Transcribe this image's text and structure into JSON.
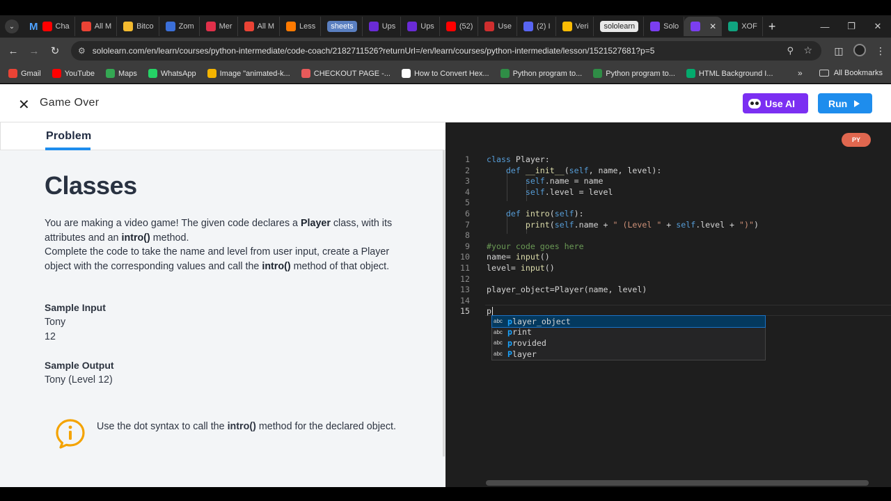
{
  "browser": {
    "tabs": [
      {
        "label": "Cha",
        "color": "#ff0000"
      },
      {
        "label": "All M",
        "color": "#ea4335"
      },
      {
        "label": "Bitco",
        "color": "#f3ba2f"
      },
      {
        "label": "Zom",
        "color": "#3b6fd8"
      },
      {
        "label": "Mer",
        "color": "#e0304a"
      },
      {
        "label": "All M",
        "color": "#ea4335"
      },
      {
        "label": "Less",
        "color": "#ff7a00"
      },
      {
        "label": "sheets",
        "color": "#5a7fc0"
      },
      {
        "label": "Ups",
        "color": "#6a2bd6"
      },
      {
        "label": "Ups",
        "color": "#6a2bd6"
      },
      {
        "label": "(52)",
        "color": "#ff0000"
      },
      {
        "label": "Use",
        "color": "#cf2e2e"
      },
      {
        "label": "(2) I",
        "color": "#5865f2"
      },
      {
        "label": "Veri",
        "color": "#fbbc04"
      },
      {
        "label": "sololearn",
        "color": "#e8e8e8"
      },
      {
        "label": "Solo",
        "color": "#7b3ef0"
      },
      {
        "label": "",
        "color": "#7b3ef0"
      },
      {
        "label": "XOF",
        "color": "#10a37f"
      }
    ],
    "first_tab_logo": "M",
    "url": "sololearn.com/en/learn/courses/python-intermediate/code-coach/2182711526?returnUrl=/en/learn/courses/python-intermediate/lesson/1521527681?p=5",
    "bookmarks": [
      {
        "label": "Gmail",
        "color": "#ea4335"
      },
      {
        "label": "YouTube",
        "color": "#ff0000"
      },
      {
        "label": "Maps",
        "color": "#34a853"
      },
      {
        "label": "WhatsApp",
        "color": "#25d366"
      },
      {
        "label": "Image \"animated-k...",
        "color": "#f4b400"
      },
      {
        "label": "CHECKOUT PAGE -...",
        "color": "#e85a5a"
      },
      {
        "label": "How to Convert Hex...",
        "color": "#ffffff"
      },
      {
        "label": "Python program to...",
        "color": "#2f8d46"
      },
      {
        "label": "Python program to...",
        "color": "#2f8d46"
      },
      {
        "label": "HTML Background I...",
        "color": "#04aa6d"
      }
    ],
    "all_bookmarks": "All Bookmarks"
  },
  "header": {
    "title": "Game Over",
    "use_ai": "Use AI",
    "run": "Run"
  },
  "problem": {
    "tab": "Problem",
    "heading": "Classes",
    "description": [
      {
        "t": "You are making a video game! The given code declares a "
      },
      {
        "t": "Player",
        "b": true
      },
      {
        "t": " class, with its attributes and an "
      },
      {
        "t": "intro()",
        "b": true
      },
      {
        "t": " method.",
        "br": true
      },
      {
        "t": "Complete the code to take the name and level from user input, create a Player object with the corresponding values and call the "
      },
      {
        "t": "intro()",
        "b": true
      },
      {
        "t": " method of that object."
      }
    ],
    "sample_input_title": "Sample Input",
    "sample_input": [
      "Tony",
      "12"
    ],
    "sample_output_title": "Sample Output",
    "sample_output": "Tony (Level 12)",
    "hint": [
      {
        "t": "Use the dot syntax to call the "
      },
      {
        "t": "intro()",
        "b": true
      },
      {
        "t": " method for the declared object."
      }
    ]
  },
  "editor": {
    "language_badge": "PY",
    "current_line": 15,
    "lines": [
      [
        {
          "t": "class ",
          "c": "kw"
        },
        {
          "t": "Player:"
        }
      ],
      [
        {
          "t": "    "
        },
        {
          "t": "def ",
          "c": "kw"
        },
        {
          "t": "__init__",
          "c": "fn"
        },
        {
          "t": "("
        },
        {
          "t": "self",
          "c": "sf"
        },
        {
          "t": ", name, level):"
        }
      ],
      [
        {
          "t": "        "
        },
        {
          "t": "self",
          "c": "sf"
        },
        {
          "t": ".name = name"
        }
      ],
      [
        {
          "t": "        "
        },
        {
          "t": "self",
          "c": "sf"
        },
        {
          "t": ".level = level"
        }
      ],
      [
        {
          "t": ""
        }
      ],
      [
        {
          "t": "    "
        },
        {
          "t": "def ",
          "c": "kw"
        },
        {
          "t": "intro",
          "c": "fn"
        },
        {
          "t": "("
        },
        {
          "t": "self",
          "c": "sf"
        },
        {
          "t": "):"
        }
      ],
      [
        {
          "t": "        "
        },
        {
          "t": "print",
          "c": "fn"
        },
        {
          "t": "("
        },
        {
          "t": "self",
          "c": "sf"
        },
        {
          "t": ".name + "
        },
        {
          "t": "\" (Level \"",
          "c": "str"
        },
        {
          "t": " + "
        },
        {
          "t": "self",
          "c": "sf"
        },
        {
          "t": ".level + "
        },
        {
          "t": "\")\"",
          "c": "str"
        },
        {
          "t": ")"
        }
      ],
      [
        {
          "t": ""
        }
      ],
      [
        {
          "t": "#your code goes here",
          "c": "cm"
        }
      ],
      [
        {
          "t": "name= "
        },
        {
          "t": "input",
          "c": "fn"
        },
        {
          "t": "()"
        }
      ],
      [
        {
          "t": "level= "
        },
        {
          "t": "input",
          "c": "fn"
        },
        {
          "t": "()"
        }
      ],
      [
        {
          "t": ""
        }
      ],
      [
        {
          "t": "player_object=Player(name, level)"
        }
      ],
      [
        {
          "t": ""
        }
      ],
      [
        {
          "t": "p"
        }
      ]
    ],
    "autocomplete": [
      {
        "kind": "abc",
        "match": "p",
        "rest": "layer_object",
        "selected": true
      },
      {
        "kind": "abc",
        "match": "p",
        "rest": "rint",
        "selected": false
      },
      {
        "kind": "abc",
        "match": "p",
        "rest": "rovided",
        "selected": false
      },
      {
        "kind": "abc",
        "match": "P",
        "rest": "layer",
        "selected": false
      }
    ]
  }
}
